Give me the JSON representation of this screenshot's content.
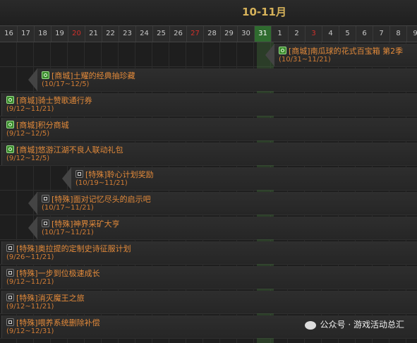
{
  "header": {
    "month_label": "10-11月"
  },
  "days": [
    {
      "label": "16",
      "red": false
    },
    {
      "label": "17",
      "red": false
    },
    {
      "label": "18",
      "red": false
    },
    {
      "label": "19",
      "red": false
    },
    {
      "label": "20",
      "red": true
    },
    {
      "label": "21",
      "red": false
    },
    {
      "label": "22",
      "red": false
    },
    {
      "label": "23",
      "red": false
    },
    {
      "label": "24",
      "red": false
    },
    {
      "label": "25",
      "red": false
    },
    {
      "label": "26",
      "red": false
    },
    {
      "label": "27",
      "red": true
    },
    {
      "label": "28",
      "red": false
    },
    {
      "label": "29",
      "red": false
    },
    {
      "label": "30",
      "red": false
    },
    {
      "label": "31",
      "today": true
    },
    {
      "label": "1",
      "red": false
    },
    {
      "label": "2",
      "red": false
    },
    {
      "label": "3",
      "red": true
    },
    {
      "label": "4",
      "red": false
    },
    {
      "label": "5",
      "red": false
    },
    {
      "label": "6",
      "red": false
    },
    {
      "label": "7",
      "red": false
    },
    {
      "label": "8",
      "red": false
    },
    {
      "label": "9",
      "red": false
    }
  ],
  "events": [
    {
      "type": "shop",
      "title": "[商城]南瓜球的花式百宝箱 第2季",
      "dates": "(10/31~11/21)"
    },
    {
      "type": "shop",
      "title": "[商城]土耀的经典抽珍藏",
      "dates": "(10/17~12/5)"
    },
    {
      "type": "shop",
      "title": "[商城]骑士赞歌通行券",
      "dates": "(9/12~11/21)"
    },
    {
      "type": "shop",
      "title": "[商城]积分商城",
      "dates": "(9/12~12/5)"
    },
    {
      "type": "shop",
      "title": "[商城]悠游江湖不良人联动礼包",
      "dates": "(9/12~12/5)"
    },
    {
      "type": "special",
      "title": "[特殊]聆心计划奖励",
      "dates": "(10/19~11/21)"
    },
    {
      "type": "special",
      "title": "[特殊]面对记忆尽头的启示吧",
      "dates": "(10/17~11/21)"
    },
    {
      "type": "special",
      "title": "[特殊]神界采矿大亨",
      "dates": "(10/17~11/21)"
    },
    {
      "type": "special",
      "title": "[特殊]奥拉提的定制史诗征服计划",
      "dates": "(9/26~11/21)"
    },
    {
      "type": "special",
      "title": "[特殊]一步到位极速成长",
      "dates": "(9/12~11/21)"
    },
    {
      "type": "special",
      "title": "[特殊]消灭魔王之旅",
      "dates": "(9/12~11/21)"
    },
    {
      "type": "special",
      "title": "[特殊]喂养系统删除补偿",
      "dates": "(9/12~12/31)"
    }
  ],
  "watermark": {
    "text": "公众号 · 游戏活动总汇"
  }
}
